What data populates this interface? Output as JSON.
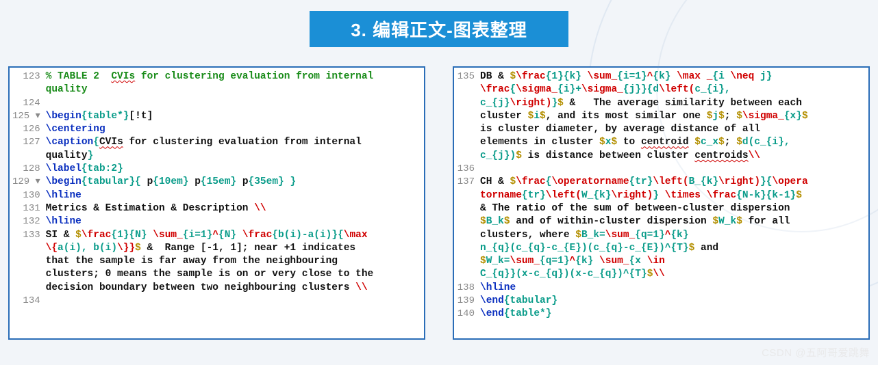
{
  "title": "3. 编辑正文-图表整理",
  "watermark": "CSDN @五阿哥爱跳舞",
  "left": {
    "lines": [
      {
        "num": "123",
        "segs": [
          {
            "t": "% TABLE 2  ",
            "cls": "c-comment"
          },
          {
            "t": "CVIs",
            "cls": "c-comment squig"
          },
          {
            "t": " for clustering evaluation from internal ",
            "cls": "c-comment"
          }
        ]
      },
      {
        "num": "",
        "segs": [
          {
            "t": "quality",
            "cls": "c-comment"
          }
        ]
      },
      {
        "num": "124",
        "segs": [
          {
            "t": " ",
            "cls": ""
          }
        ]
      },
      {
        "num": "125 ▾",
        "segs": [
          {
            "t": "\\begin",
            "cls": "c-cmd"
          },
          {
            "t": "{table*}",
            "cls": "c-brace"
          },
          {
            "t": "[!t]",
            "cls": "c-black"
          }
        ]
      },
      {
        "num": "126",
        "segs": [
          {
            "t": "\\centering",
            "cls": "c-cmd"
          }
        ]
      },
      {
        "num": "127",
        "segs": [
          {
            "t": "\\caption",
            "cls": "c-cmd"
          },
          {
            "t": "{",
            "cls": "c-brace"
          },
          {
            "t": "CVIs",
            "cls": "c-black squig"
          },
          {
            "t": " for clustering evaluation from internal ",
            "cls": "c-black"
          }
        ]
      },
      {
        "num": "",
        "segs": [
          {
            "t": "quality",
            "cls": "c-black"
          },
          {
            "t": "}",
            "cls": "c-brace"
          }
        ]
      },
      {
        "num": "128",
        "segs": [
          {
            "t": "\\label",
            "cls": "c-cmd"
          },
          {
            "t": "{tab:2}",
            "cls": "c-brace"
          }
        ]
      },
      {
        "num": "129 ▾",
        "segs": [
          {
            "t": "\\begin",
            "cls": "c-cmd"
          },
          {
            "t": "{tabular}{",
            "cls": "c-brace"
          },
          {
            "t": " p",
            "cls": "c-black"
          },
          {
            "t": "{10em}",
            "cls": "c-brace"
          },
          {
            "t": " p",
            "cls": "c-black"
          },
          {
            "t": "{15em}",
            "cls": "c-brace"
          },
          {
            "t": " p",
            "cls": "c-black"
          },
          {
            "t": "{35em}",
            "cls": "c-brace"
          },
          {
            "t": " }",
            "cls": "c-brace"
          }
        ]
      },
      {
        "num": "130",
        "segs": [
          {
            "t": "\\hline",
            "cls": "c-cmd"
          }
        ]
      },
      {
        "num": "131",
        "segs": [
          {
            "t": "Metrics & Estimation & Description ",
            "cls": "c-black"
          },
          {
            "t": "\\\\",
            "cls": "c-math"
          }
        ]
      },
      {
        "num": "132",
        "segs": [
          {
            "t": "\\hline",
            "cls": "c-cmd"
          }
        ]
      },
      {
        "num": "133",
        "segs": [
          {
            "t": "SI & ",
            "cls": "c-black"
          },
          {
            "t": "$",
            "cls": "c-delim"
          },
          {
            "t": "\\frac",
            "cls": "c-math"
          },
          {
            "t": "{1}{N}",
            "cls": "c-brace"
          },
          {
            "t": " \\sum_",
            "cls": "c-math"
          },
          {
            "t": "{i=1}",
            "cls": "c-brace"
          },
          {
            "t": "^",
            "cls": "c-math"
          },
          {
            "t": "{N}",
            "cls": "c-brace"
          },
          {
            "t": " \\frac",
            "cls": "c-math"
          },
          {
            "t": "{b(i)-a(i)}{",
            "cls": "c-brace"
          },
          {
            "t": "\\max ",
            "cls": "c-math"
          }
        ]
      },
      {
        "num": "",
        "segs": [
          {
            "t": "\\{",
            "cls": "c-math"
          },
          {
            "t": "a(i), b(i)",
            "cls": "c-brace"
          },
          {
            "t": "\\}}",
            "cls": "c-math"
          },
          {
            "t": "$",
            "cls": "c-delim"
          },
          {
            "t": " &  Range [-1, 1]; near +1 indicates ",
            "cls": "c-black"
          }
        ]
      },
      {
        "num": "",
        "segs": [
          {
            "t": "that the sample is far away from the neighbouring ",
            "cls": "c-black"
          }
        ]
      },
      {
        "num": "",
        "segs": [
          {
            "t": "clusters; 0 means the sample is on or very close to the ",
            "cls": "c-black"
          }
        ]
      },
      {
        "num": "",
        "segs": [
          {
            "t": "decision boundary between two neighbouring clusters ",
            "cls": "c-black"
          },
          {
            "t": "\\\\",
            "cls": "c-math"
          }
        ]
      },
      {
        "num": "134",
        "segs": [
          {
            "t": " ",
            "cls": ""
          }
        ]
      }
    ]
  },
  "right": {
    "lines": [
      {
        "num": "135",
        "segs": [
          {
            "t": "DB & ",
            "cls": "c-black"
          },
          {
            "t": "$",
            "cls": "c-delim"
          },
          {
            "t": "\\frac",
            "cls": "c-math"
          },
          {
            "t": "{1}{k}",
            "cls": "c-brace"
          },
          {
            "t": " \\sum_",
            "cls": "c-math"
          },
          {
            "t": "{i=1}",
            "cls": "c-brace"
          },
          {
            "t": "^",
            "cls": "c-math"
          },
          {
            "t": "{k}",
            "cls": "c-brace"
          },
          {
            "t": " \\max _",
            "cls": "c-math"
          },
          {
            "t": "{i ",
            "cls": "c-brace"
          },
          {
            "t": "\\neq",
            "cls": "c-math"
          },
          {
            "t": " j}",
            "cls": "c-brace"
          }
        ]
      },
      {
        "num": "",
        "segs": [
          {
            "t": "\\frac",
            "cls": "c-math"
          },
          {
            "t": "{",
            "cls": "c-brace"
          },
          {
            "t": "\\sigma_",
            "cls": "c-math"
          },
          {
            "t": "{i}",
            "cls": "c-brace"
          },
          {
            "t": "+",
            "cls": "c-brace"
          },
          {
            "t": "\\sigma_",
            "cls": "c-math"
          },
          {
            "t": "{j}}{d",
            "cls": "c-brace"
          },
          {
            "t": "\\left(",
            "cls": "c-math"
          },
          {
            "t": "c_",
            "cls": "c-brace"
          },
          {
            "t": "{i}",
            "cls": "c-brace"
          },
          {
            "t": ", ",
            "cls": "c-brace"
          }
        ]
      },
      {
        "num": "",
        "segs": [
          {
            "t": "c_",
            "cls": "c-brace"
          },
          {
            "t": "{j}",
            "cls": "c-brace"
          },
          {
            "t": "\\right)",
            "cls": "c-math"
          },
          {
            "t": "}",
            "cls": "c-brace"
          },
          {
            "t": "$",
            "cls": "c-delim"
          },
          {
            "t": " &   The average similarity between each ",
            "cls": "c-black"
          }
        ]
      },
      {
        "num": "",
        "segs": [
          {
            "t": "cluster ",
            "cls": "c-black"
          },
          {
            "t": "$",
            "cls": "c-delim"
          },
          {
            "t": "i",
            "cls": "c-brace"
          },
          {
            "t": "$",
            "cls": "c-delim"
          },
          {
            "t": ", and its most similar one ",
            "cls": "c-black"
          },
          {
            "t": "$",
            "cls": "c-delim"
          },
          {
            "t": "j",
            "cls": "c-brace"
          },
          {
            "t": "$",
            "cls": "c-delim"
          },
          {
            "t": "; ",
            "cls": "c-black"
          },
          {
            "t": "$",
            "cls": "c-delim"
          },
          {
            "t": "\\sigma_",
            "cls": "c-math"
          },
          {
            "t": "{x}",
            "cls": "c-brace"
          },
          {
            "t": "$",
            "cls": "c-delim"
          },
          {
            "t": " ",
            "cls": "c-black"
          }
        ]
      },
      {
        "num": "",
        "segs": [
          {
            "t": "is cluster diameter, by average distance of all ",
            "cls": "c-black"
          }
        ]
      },
      {
        "num": "",
        "segs": [
          {
            "t": "elements in cluster ",
            "cls": "c-black"
          },
          {
            "t": "$",
            "cls": "c-delim"
          },
          {
            "t": "x",
            "cls": "c-brace"
          },
          {
            "t": "$",
            "cls": "c-delim"
          },
          {
            "t": " to ",
            "cls": "c-black"
          },
          {
            "t": "centroid",
            "cls": "c-black squig"
          },
          {
            "t": " ",
            "cls": "c-black"
          },
          {
            "t": "$",
            "cls": "c-delim"
          },
          {
            "t": "c_x",
            "cls": "c-brace"
          },
          {
            "t": "$",
            "cls": "c-delim"
          },
          {
            "t": "; ",
            "cls": "c-black"
          },
          {
            "t": "$",
            "cls": "c-delim"
          },
          {
            "t": "d(c_",
            "cls": "c-brace"
          },
          {
            "t": "{i}",
            "cls": "c-brace"
          },
          {
            "t": ", ",
            "cls": "c-brace"
          }
        ]
      },
      {
        "num": "",
        "segs": [
          {
            "t": "c_",
            "cls": "c-brace"
          },
          {
            "t": "{j}",
            "cls": "c-brace"
          },
          {
            "t": ")",
            "cls": "c-brace"
          },
          {
            "t": "$",
            "cls": "c-delim"
          },
          {
            "t": " is distance between cluster ",
            "cls": "c-black"
          },
          {
            "t": "centroids",
            "cls": "c-black squig"
          },
          {
            "t": "\\\\",
            "cls": "c-math"
          }
        ]
      },
      {
        "num": "136",
        "segs": [
          {
            "t": " ",
            "cls": ""
          }
        ]
      },
      {
        "num": "137",
        "segs": [
          {
            "t": "CH & ",
            "cls": "c-black"
          },
          {
            "t": "$",
            "cls": "c-delim"
          },
          {
            "t": "\\frac",
            "cls": "c-math"
          },
          {
            "t": "{",
            "cls": "c-brace"
          },
          {
            "t": "\\operatorname",
            "cls": "c-math"
          },
          {
            "t": "{tr}",
            "cls": "c-brace"
          },
          {
            "t": "\\left(",
            "cls": "c-math"
          },
          {
            "t": "B_",
            "cls": "c-brace"
          },
          {
            "t": "{k}",
            "cls": "c-brace"
          },
          {
            "t": "\\right)",
            "cls": "c-math"
          },
          {
            "t": "}{",
            "cls": "c-brace"
          },
          {
            "t": "\\opera",
            "cls": "c-math"
          }
        ]
      },
      {
        "num": "",
        "segs": [
          {
            "t": "torname",
            "cls": "c-math"
          },
          {
            "t": "{tr}",
            "cls": "c-brace"
          },
          {
            "t": "\\left(",
            "cls": "c-math"
          },
          {
            "t": "W_",
            "cls": "c-brace"
          },
          {
            "t": "{k}",
            "cls": "c-brace"
          },
          {
            "t": "\\right)",
            "cls": "c-math"
          },
          {
            "t": "}",
            "cls": "c-brace"
          },
          {
            "t": " \\times \\frac",
            "cls": "c-math"
          },
          {
            "t": "{N-k}{k-1}",
            "cls": "c-brace"
          },
          {
            "t": "$",
            "cls": "c-delim"
          },
          {
            "t": " ",
            "cls": "c-black"
          }
        ]
      },
      {
        "num": "",
        "segs": [
          {
            "t": "& The ratio of the sum of between-cluster dispersion ",
            "cls": "c-black"
          }
        ]
      },
      {
        "num": "",
        "segs": [
          {
            "t": "$",
            "cls": "c-delim"
          },
          {
            "t": "B_k",
            "cls": "c-brace"
          },
          {
            "t": "$",
            "cls": "c-delim"
          },
          {
            "t": " and of within-cluster dispersion ",
            "cls": "c-black"
          },
          {
            "t": "$",
            "cls": "c-delim"
          },
          {
            "t": "W_k",
            "cls": "c-brace"
          },
          {
            "t": "$",
            "cls": "c-delim"
          },
          {
            "t": " for all ",
            "cls": "c-black"
          }
        ]
      },
      {
        "num": "",
        "segs": [
          {
            "t": "clusters, where ",
            "cls": "c-black"
          },
          {
            "t": "$",
            "cls": "c-delim"
          },
          {
            "t": "B_k=",
            "cls": "c-brace"
          },
          {
            "t": "\\sum_",
            "cls": "c-math"
          },
          {
            "t": "{q=1}",
            "cls": "c-brace"
          },
          {
            "t": "^",
            "cls": "c-math"
          },
          {
            "t": "{k}",
            "cls": "c-brace"
          },
          {
            "t": " ",
            "cls": "c-brace"
          }
        ]
      },
      {
        "num": "",
        "segs": [
          {
            "t": "n_",
            "cls": "c-brace"
          },
          {
            "t": "{q}",
            "cls": "c-brace"
          },
          {
            "t": "(c_",
            "cls": "c-brace"
          },
          {
            "t": "{q}",
            "cls": "c-brace"
          },
          {
            "t": "-c_",
            "cls": "c-brace"
          },
          {
            "t": "{E}",
            "cls": "c-brace"
          },
          {
            "t": ")(c_",
            "cls": "c-brace"
          },
          {
            "t": "{q}",
            "cls": "c-brace"
          },
          {
            "t": "-c_",
            "cls": "c-brace"
          },
          {
            "t": "{E}",
            "cls": "c-brace"
          },
          {
            "t": ")^",
            "cls": "c-brace"
          },
          {
            "t": "{T}",
            "cls": "c-brace"
          },
          {
            "t": "$",
            "cls": "c-delim"
          },
          {
            "t": " and ",
            "cls": "c-black"
          }
        ]
      },
      {
        "num": "",
        "segs": [
          {
            "t": "$",
            "cls": "c-delim"
          },
          {
            "t": "W_k=",
            "cls": "c-brace"
          },
          {
            "t": "\\sum_",
            "cls": "c-math"
          },
          {
            "t": "{q=1}",
            "cls": "c-brace"
          },
          {
            "t": "^",
            "cls": "c-math"
          },
          {
            "t": "{k}",
            "cls": "c-brace"
          },
          {
            "t": " \\sum_",
            "cls": "c-math"
          },
          {
            "t": "{x ",
            "cls": "c-brace"
          },
          {
            "t": "\\in",
            "cls": "c-math"
          },
          {
            "t": " ",
            "cls": "c-brace"
          }
        ]
      },
      {
        "num": "",
        "segs": [
          {
            "t": "C_",
            "cls": "c-brace"
          },
          {
            "t": "{q}}",
            "cls": "c-brace"
          },
          {
            "t": "(x-c_",
            "cls": "c-brace"
          },
          {
            "t": "{q}",
            "cls": "c-brace"
          },
          {
            "t": ")(x-c_",
            "cls": "c-brace"
          },
          {
            "t": "{q}",
            "cls": "c-brace"
          },
          {
            "t": ")^",
            "cls": "c-brace"
          },
          {
            "t": "{T}",
            "cls": "c-brace"
          },
          {
            "t": "$",
            "cls": "c-delim"
          },
          {
            "t": "\\\\",
            "cls": "c-math"
          }
        ]
      },
      {
        "num": "138",
        "segs": [
          {
            "t": "\\hline",
            "cls": "c-cmd"
          }
        ]
      },
      {
        "num": "139",
        "segs": [
          {
            "t": "\\end",
            "cls": "c-cmd"
          },
          {
            "t": "{tabular}",
            "cls": "c-brace"
          }
        ]
      },
      {
        "num": "140",
        "segs": [
          {
            "t": "\\end",
            "cls": "c-cmd"
          },
          {
            "t": "{table*}",
            "cls": "c-brace"
          }
        ]
      }
    ]
  }
}
